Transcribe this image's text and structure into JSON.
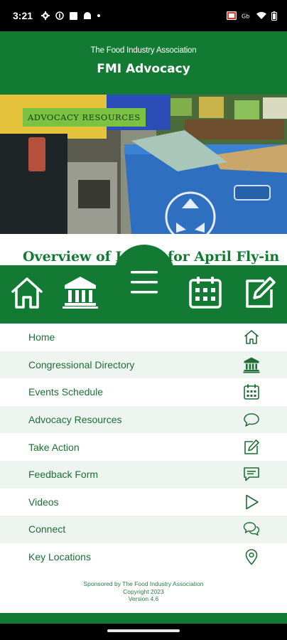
{
  "status_bar": {
    "time": "3:21",
    "left_icons": [
      "settings-icon",
      "info-icon",
      "square-icon",
      "android-icon",
      "dot-icon"
    ],
    "right_icons": [
      "cast-icon",
      "hd-icon",
      "wifi-icon",
      "battery-icon"
    ]
  },
  "header": {
    "subtitle": "The Food Industry Association",
    "title": "FMI Advocacy"
  },
  "hero": {
    "badge": "ADVOCACY RESOURCES",
    "image_icon": "recycling-icon"
  },
  "article": {
    "title": "Overview of Issues for April Fly-in"
  },
  "bottom_nav": {
    "items": [
      {
        "icon": "home-icon"
      },
      {
        "icon": "capitol-icon"
      },
      {
        "icon": "menu-icon"
      },
      {
        "icon": "calendar-icon"
      },
      {
        "icon": "edit-icon"
      }
    ]
  },
  "menu": {
    "items": [
      {
        "label": "Home",
        "icon": "home-icon"
      },
      {
        "label": "Congressional Directory",
        "icon": "capitol-icon"
      },
      {
        "label": "Events Schedule",
        "icon": "calendar-icon"
      },
      {
        "label": "Advocacy Resources",
        "icon": "speech-bubble-icon"
      },
      {
        "label": "Take Action",
        "icon": "edit-icon"
      },
      {
        "label": "Feedback Form",
        "icon": "feedback-icon"
      },
      {
        "label": "Videos",
        "icon": "play-icon"
      },
      {
        "label": "Connect",
        "icon": "chat-icon"
      },
      {
        "label": "Key Locations",
        "icon": "map-pin-icon"
      }
    ]
  },
  "footer": {
    "sponsor": "Sponsored by The Food Industry Association",
    "copyright": "Copyright 2023",
    "version": "Version 4.6"
  },
  "colors": {
    "brand_green": "#137a34",
    "badge_green": "#7cc242",
    "row_alt": "#eef5f1"
  }
}
